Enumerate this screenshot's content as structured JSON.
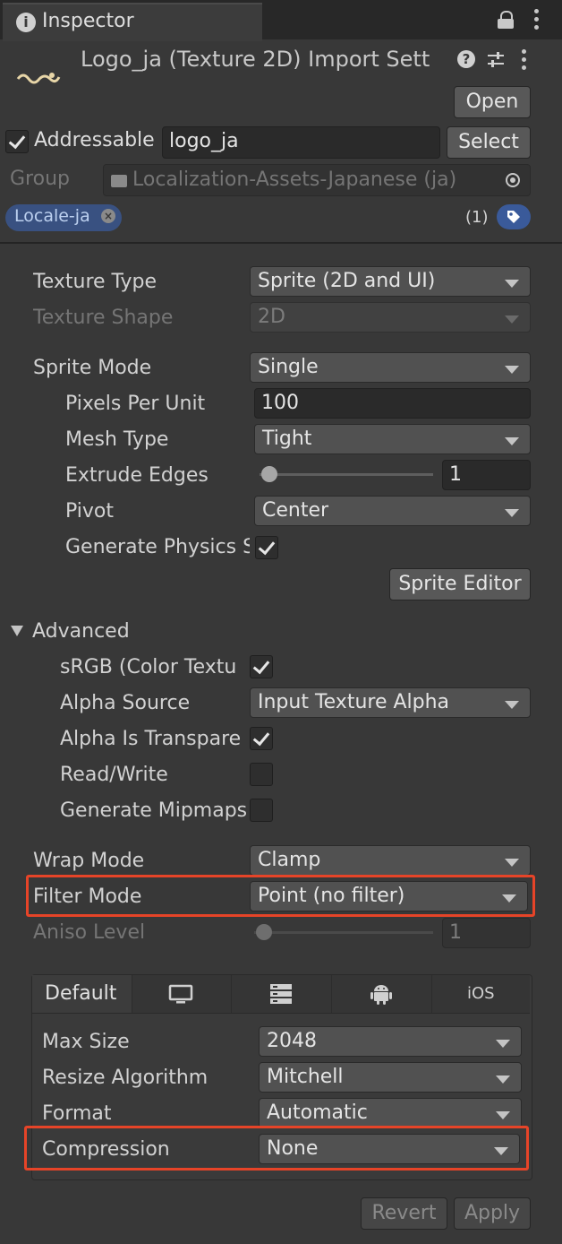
{
  "tab": {
    "title": "Inspector",
    "icon": "info-icon"
  },
  "header": {
    "title": "Logo_ja (Texture 2D) Import Sett",
    "open_label": "Open"
  },
  "addressable": {
    "label": "Addressable",
    "checked": true,
    "address": "logo_ja",
    "select_label": "Select"
  },
  "group": {
    "label": "Group",
    "value": "Localization-Assets-Japanese (ja)"
  },
  "label_tag": {
    "text": "Locale-ja",
    "count": "(1)"
  },
  "settings": {
    "texture_type": {
      "label": "Texture Type",
      "value": "Sprite (2D and UI)"
    },
    "texture_shape": {
      "label": "Texture Shape",
      "value": "2D"
    },
    "sprite_mode": {
      "label": "Sprite Mode",
      "value": "Single"
    },
    "pixels_per_unit": {
      "label": "Pixels Per Unit",
      "value": "100"
    },
    "mesh_type": {
      "label": "Mesh Type",
      "value": "Tight"
    },
    "extrude_edges": {
      "label": "Extrude Edges",
      "value": "1",
      "slider_fraction": 0.03
    },
    "pivot": {
      "label": "Pivot",
      "value": "Center"
    },
    "generate_physics": {
      "label": "Generate Physics S",
      "checked": true
    },
    "sprite_editor_label": "Sprite Editor"
  },
  "advanced": {
    "label": "Advanced",
    "srgb": {
      "label": "sRGB (Color Textu",
      "checked": true
    },
    "alpha_source": {
      "label": "Alpha Source",
      "value": "Input Texture Alpha"
    },
    "alpha_transparency": {
      "label": "Alpha Is Transpare",
      "checked": true
    },
    "read_write": {
      "label": "Read/Write",
      "checked": false
    },
    "mipmaps": {
      "label": "Generate Mipmaps",
      "checked": false
    }
  },
  "wrap_mode": {
    "label": "Wrap Mode",
    "value": "Clamp"
  },
  "filter_mode": {
    "label": "Filter Mode",
    "value": "Point (no filter)"
  },
  "aniso_level": {
    "label": "Aniso Level",
    "value": "1",
    "slider_fraction": 0.03
  },
  "platform": {
    "tabs": [
      {
        "label": "Default",
        "icon": null
      },
      {
        "label": "",
        "icon": "monitor-icon"
      },
      {
        "label": "",
        "icon": "server-rack-icon"
      },
      {
        "label": "",
        "icon": "android-icon"
      },
      {
        "label": "iOS",
        "icon": null
      }
    ],
    "max_size": {
      "label": "Max Size",
      "value": "2048"
    },
    "resize_algorithm": {
      "label": "Resize Algorithm",
      "value": "Mitchell"
    },
    "format": {
      "label": "Format",
      "value": "Automatic"
    },
    "compression": {
      "label": "Compression",
      "value": "None"
    }
  },
  "footer": {
    "revert_label": "Revert",
    "apply_label": "Apply"
  },
  "colors": {
    "highlight": "#e64428",
    "tag_blue": "#3a5a9a"
  }
}
